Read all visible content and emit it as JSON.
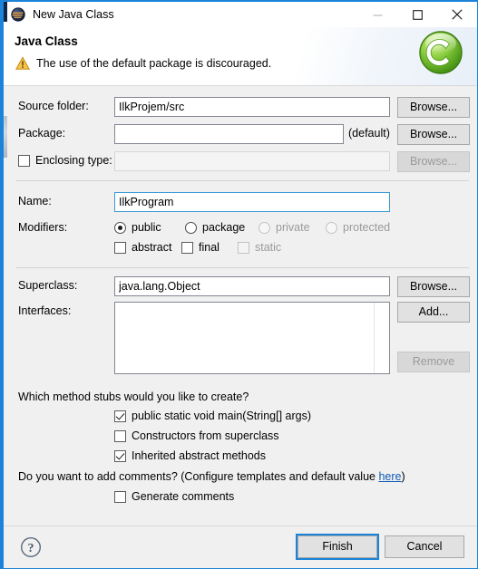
{
  "window": {
    "title": "New Java Class",
    "icon": "eclipse-icon",
    "controls": {
      "minimize": "minimize-icon",
      "maximize": "maximize-icon",
      "close": "close-icon"
    }
  },
  "header": {
    "title": "Java Class",
    "message": "The use of the default package is discouraged.",
    "message_icon": "warning-icon",
    "logo": "java-class-c-icon"
  },
  "form": {
    "source_folder": {
      "label": "Source folder:",
      "value": "IlkProjem/src",
      "browse": "Browse..."
    },
    "package": {
      "label": "Package:",
      "value": "",
      "placeholder": "",
      "default_hint": "(default)",
      "browse": "Browse..."
    },
    "enclosing_type": {
      "label": "Enclosing type:",
      "checked": false,
      "value": "",
      "browse": "Browse...",
      "disabled": true
    },
    "name": {
      "label": "Name:",
      "value": "IlkProgram",
      "focused": true
    },
    "modifiers": {
      "label": "Modifiers:",
      "radios": [
        {
          "label": "public",
          "selected": true,
          "disabled": false
        },
        {
          "label": "package",
          "selected": false,
          "disabled": false
        },
        {
          "label": "private",
          "selected": false,
          "disabled": true
        },
        {
          "label": "protected",
          "selected": false,
          "disabled": true
        }
      ],
      "checkboxes": [
        {
          "label": "abstract",
          "checked": false,
          "disabled": false
        },
        {
          "label": "final",
          "checked": false,
          "disabled": false
        },
        {
          "label": "static",
          "checked": false,
          "disabled": true
        }
      ]
    },
    "superclass": {
      "label": "Superclass:",
      "value": "java.lang.Object",
      "browse": "Browse..."
    },
    "interfaces": {
      "label": "Interfaces:",
      "items": [],
      "add": "Add...",
      "remove": "Remove",
      "remove_disabled": true
    }
  },
  "stubs": {
    "question": "Which method stubs would you like to create?",
    "options": [
      {
        "label": "public static void main(String[] args)",
        "checked": true
      },
      {
        "label": "Constructors from superclass",
        "checked": false
      },
      {
        "label": "Inherited abstract methods",
        "checked": true
      }
    ]
  },
  "comments": {
    "question_before": "Do you want to add comments? (Configure templates and default value ",
    "link": "here",
    "question_after": ")",
    "option": {
      "label": "Generate comments",
      "checked": false
    }
  },
  "footer": {
    "help": "help-icon",
    "finish": "Finish",
    "cancel": "Cancel"
  },
  "colors": {
    "accent": "#1b84d8",
    "body": "#f0f0f0",
    "field_border": "#828790",
    "link": "#0f5bb5",
    "warning": "#f0ad20",
    "logo_green": "#6fbf2f"
  }
}
